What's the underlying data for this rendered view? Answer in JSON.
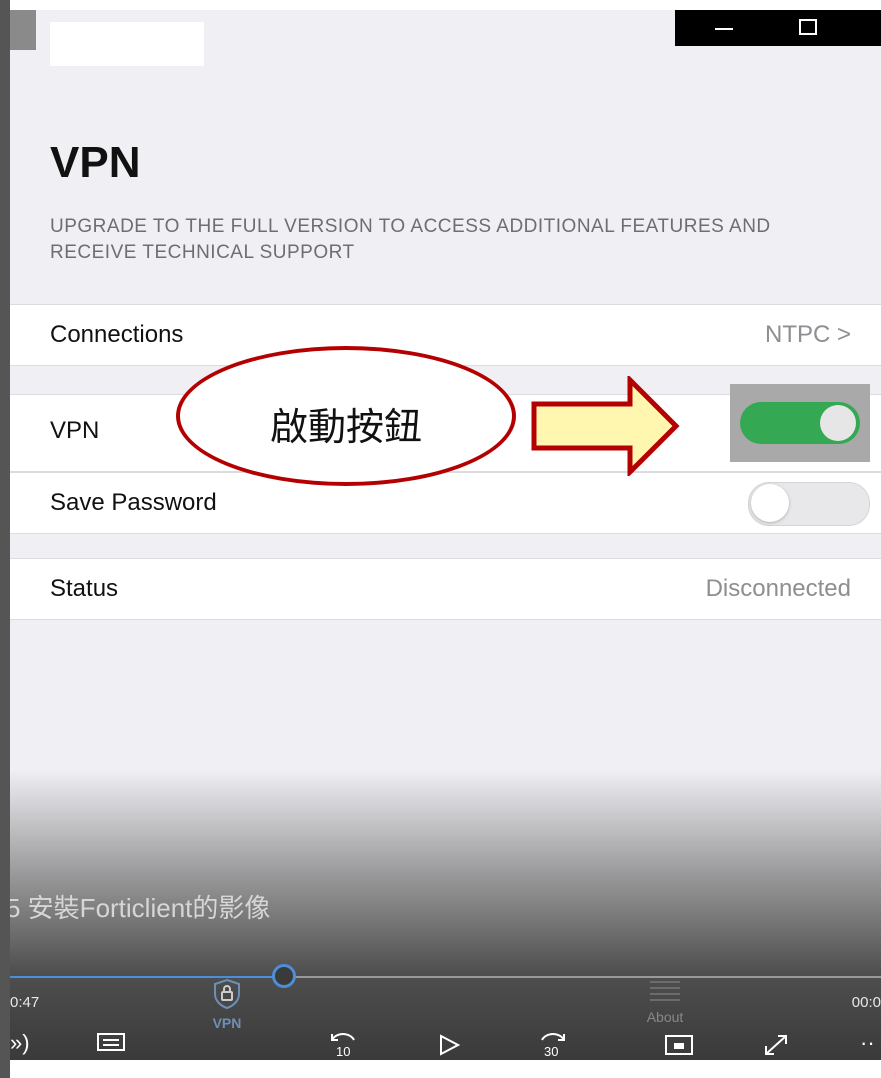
{
  "status_bar": {
    "window_controls": {
      "minimize_icon": "minimize-icon",
      "maximize_icon": "maximize-icon"
    }
  },
  "page": {
    "title": "VPN",
    "upgrade_notice": "UPGRADE TO THE FULL VERSION TO ACCESS ADDITIONAL FEATURES AND RECEIVE TECHNICAL SUPPORT"
  },
  "rows": {
    "connections": {
      "label": "Connections",
      "value": "NTPC >"
    },
    "vpn": {
      "label": "VPN",
      "toggle_on": true
    },
    "save_password": {
      "label": "Save Password",
      "toggle_on": false
    },
    "status": {
      "label": "Status",
      "value": "Disconnected"
    }
  },
  "annotation": {
    "callout_text": "啟動按鈕",
    "colors": {
      "ellipse": "#b40000",
      "arrow_fill": "#fff7b0",
      "arrow_stroke": "#b40000"
    }
  },
  "video_player": {
    "caption": "5 安裝Forticlient的影像",
    "time_elapsed": "0:47",
    "time_remaining": "00:0",
    "progress": 0.31,
    "tabs": {
      "vpn_label": "VPN",
      "about_label": "About"
    },
    "controls": [
      "volume-icon",
      "subtitles-icon",
      "rewind-10-icon",
      "play-icon",
      "forward-30-icon",
      "miniplayer-icon",
      "fullscreen-icon",
      "more-icon"
    ]
  },
  "colors": {
    "toggle_on": "#34a853",
    "progress": "#4c8ed9",
    "background": "#efeff4"
  }
}
